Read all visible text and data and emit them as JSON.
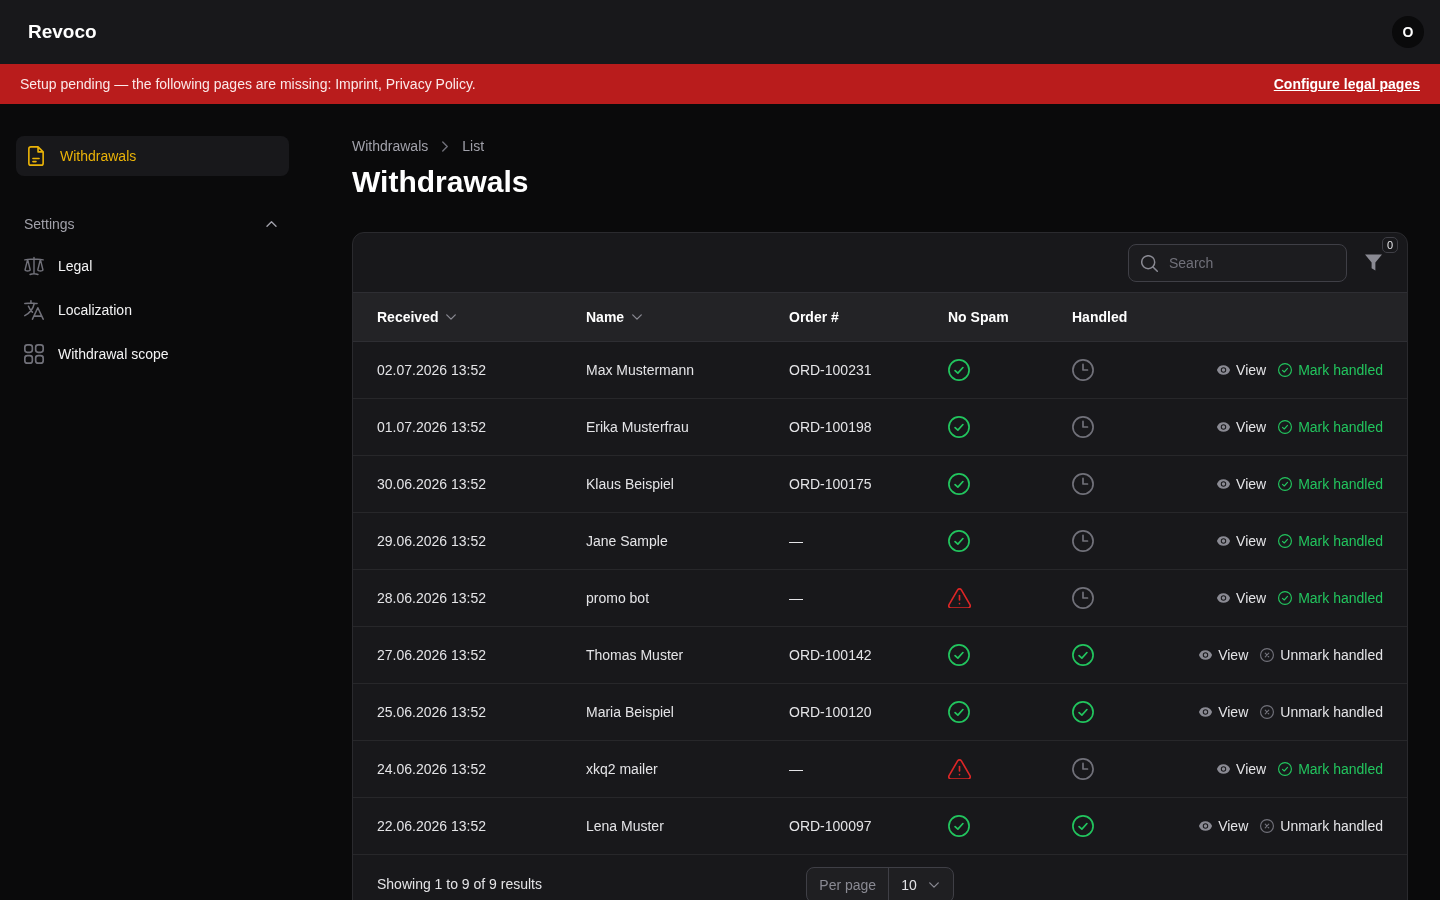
{
  "header": {
    "logo": "Revoco",
    "avatar": "O"
  },
  "banner": {
    "message": "Setup pending — the following pages are missing: Imprint, Privacy Policy.",
    "link": "Configure legal pages"
  },
  "sidebar": {
    "items": [
      {
        "label": "Withdrawals",
        "selected": true
      }
    ],
    "groups": [
      {
        "label": "Settings",
        "expanded": true,
        "items": [
          {
            "label": "Legal",
            "selected": false
          },
          {
            "label": "Localization",
            "selected": false
          },
          {
            "label": "Withdrawal scope",
            "selected": false
          }
        ]
      }
    ]
  },
  "breadcrumbs": [
    "Withdrawals",
    "List"
  ],
  "page_title": "Withdrawals",
  "table": {
    "search": {
      "placeholder": "Search"
    },
    "filter_count": "0",
    "columns": [
      {
        "label": "Received",
        "sortable": true
      },
      {
        "label": "Name",
        "sortable": true
      },
      {
        "label": "Order #",
        "sortable": false
      },
      {
        "label": "No Spam",
        "sortable": false
      },
      {
        "label": "Handled",
        "sortable": false
      }
    ],
    "rows": [
      {
        "received": "02.07.2026 13:52",
        "name": "Max Mustermann",
        "order": "ORD-100231",
        "no_spam": true,
        "handled": false,
        "view": "View",
        "toggle": "Mark handled"
      },
      {
        "received": "01.07.2026 13:52",
        "name": "Erika Musterfrau",
        "order": "ORD-100198",
        "no_spam": true,
        "handled": false,
        "view": "View",
        "toggle": "Mark handled"
      },
      {
        "received": "30.06.2026 13:52",
        "name": "Klaus Beispiel",
        "order": "ORD-100175",
        "no_spam": true,
        "handled": false,
        "view": "View",
        "toggle": "Mark handled"
      },
      {
        "received": "29.06.2026 13:52",
        "name": "Jane Sample",
        "order": "—",
        "no_spam": true,
        "handled": false,
        "view": "View",
        "toggle": "Mark handled"
      },
      {
        "received": "28.06.2026 13:52",
        "name": "promo bot",
        "order": "—",
        "no_spam": false,
        "handled": false,
        "view": "View",
        "toggle": "Mark handled"
      },
      {
        "received": "27.06.2026 13:52",
        "name": "Thomas Muster",
        "order": "ORD-100142",
        "no_spam": true,
        "handled": true,
        "view": "View",
        "toggle": "Unmark handled"
      },
      {
        "received": "25.06.2026 13:52",
        "name": "Maria Beispiel",
        "order": "ORD-100120",
        "no_spam": true,
        "handled": true,
        "view": "View",
        "toggle": "Unmark handled"
      },
      {
        "received": "24.06.2026 13:52",
        "name": "xkq2 mailer",
        "order": "—",
        "no_spam": false,
        "handled": false,
        "view": "View",
        "toggle": "Mark handled"
      },
      {
        "received": "22.06.2026 13:52",
        "name": "Lena Muster",
        "order": "ORD-100097",
        "no_spam": true,
        "handled": true,
        "view": "View",
        "toggle": "Unmark handled"
      }
    ],
    "footer": {
      "summary": "Showing 1 to 9 of 9 results",
      "per_page_label": "Per page",
      "per_page": "10"
    }
  }
}
